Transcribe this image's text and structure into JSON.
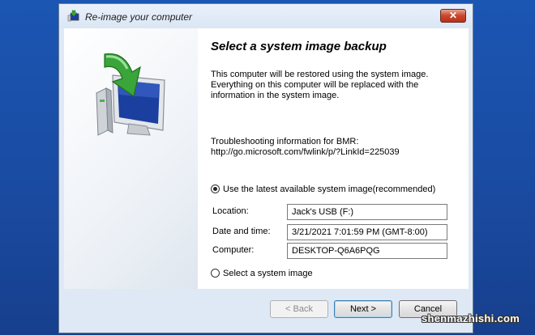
{
  "window": {
    "title": "Re-image your computer",
    "close_label": "✕"
  },
  "main": {
    "heading": "Select a system image backup",
    "description_lines": [
      "This computer will be restored using the system image.",
      "Everything on this computer will be replaced with the",
      "information in the system image."
    ],
    "troubleshooting_lines": [
      "Troubleshooting information for BMR:",
      "http://go.microsoft.com/fwlink/p/?LinkId=225039"
    ],
    "option_latest": {
      "label": "Use the latest available system image(recommended)",
      "selected": true
    },
    "fields": {
      "location": {
        "label": "Location:",
        "value": "Jack's USB (F:)"
      },
      "date": {
        "label": "Date and time:",
        "value": "3/21/2021 7:01:59 PM (GMT-8:00)"
      },
      "computer": {
        "label": "Computer:",
        "value": "DESKTOP-Q6A6PQG"
      }
    },
    "option_select": {
      "label": "Select a system image",
      "selected": false
    }
  },
  "buttons": {
    "back": "< Back",
    "next": "Next >",
    "cancel": "Cancel"
  },
  "watermark": "shenmazhishi.com",
  "colors": {
    "desktop": "#1a4fa3",
    "window_frame": "#dfe9f5",
    "close": "#c9452b",
    "icon_arrow": "#3aa53a",
    "icon_screen": "#1b3f9e"
  },
  "icons": {
    "title": "restore-computer-icon",
    "hero": "computer-restore-arrow-icon"
  }
}
